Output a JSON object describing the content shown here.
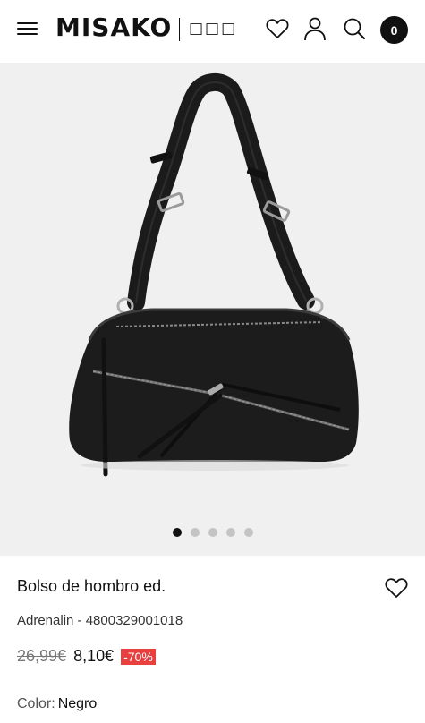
{
  "header": {
    "logo": "MISAKO",
    "logo_sub": "□□□",
    "cart_count": "0",
    "icons": [
      "menu-icon",
      "heart-icon",
      "user-icon",
      "search-icon"
    ]
  },
  "gallery": {
    "image_alt": "handbag",
    "slide_count": 5,
    "active_slide": 1
  },
  "product": {
    "title": "Bolso de hombro ed.",
    "reference": "Adrenalin - 4800329001018",
    "old_price": "26,99€",
    "new_price": "8,10€",
    "discount": "-70%",
    "color_label": "Color:",
    "color_value": "Negro"
  },
  "colors": {
    "accent": "#111111",
    "discount_bg": "#e8403f",
    "gallery_bg": "#f0f0f0"
  }
}
